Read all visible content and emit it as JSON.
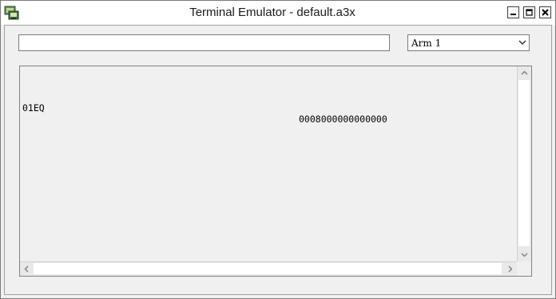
{
  "window": {
    "title": "Terminal Emulator - default.a3x"
  },
  "icons": {
    "app": "terminal-app-icon",
    "minimize": "minimize-icon",
    "maximize": "maximize-icon",
    "close": "close-icon"
  },
  "command": {
    "value": ""
  },
  "device_select": {
    "selected": "Arm 1"
  },
  "terminal": {
    "lines": [
      {
        "col1": "01EQ",
        "col2": "0008000000000000"
      }
    ]
  }
}
